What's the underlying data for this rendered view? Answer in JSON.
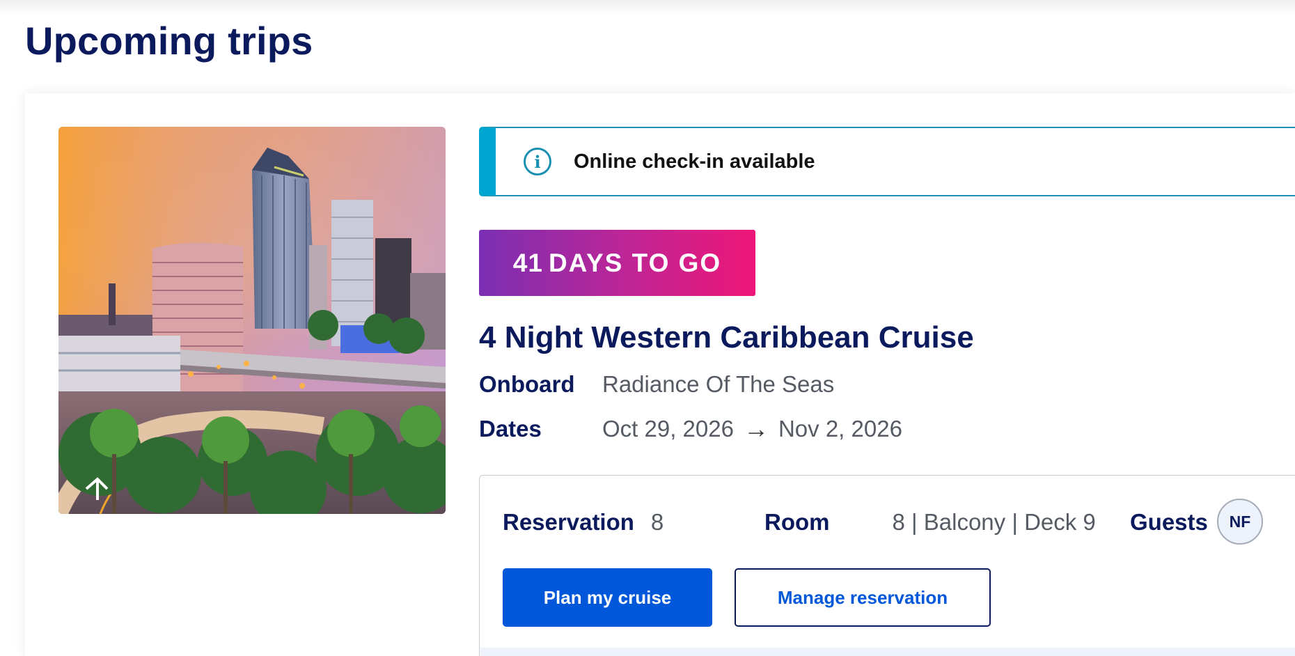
{
  "page": {
    "title": "Upcoming trips"
  },
  "trip": {
    "image_alt": "City skyline at sunset with palm trees",
    "banner": {
      "icon": "info-icon",
      "text": "Online check-in available"
    },
    "countdown": {
      "days": "41",
      "label": "DAYS TO GO"
    },
    "title": "4 Night Western Caribbean Cruise",
    "onboard": {
      "label": "Onboard",
      "value": "Radiance Of The Seas"
    },
    "dates": {
      "label": "Dates",
      "start": "Oct 29, 2026",
      "arrow": "→",
      "end": "Nov 2, 2026"
    },
    "reservation": {
      "label": "Reservation",
      "value": "8"
    },
    "room": {
      "label": "Room",
      "value": "8 | Balcony | Deck 9"
    },
    "guests": {
      "label": "Guests",
      "initials": "NF"
    },
    "actions": {
      "plan_label": "Plan my cruise",
      "manage_label": "Manage reservation"
    }
  },
  "colors": {
    "navy": "#0b1a5c",
    "accent_blue": "#0057d9",
    "banner_teal": "#00a6cf",
    "countdown_start": "#7a2fb3",
    "countdown_end": "#ee1677"
  }
}
